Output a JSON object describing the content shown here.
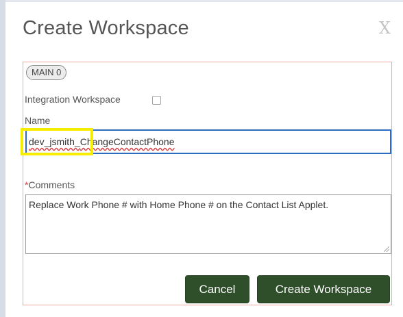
{
  "dialog": {
    "title": "Create Workspace",
    "close_symbol": "X"
  },
  "form": {
    "badge": "MAIN 0",
    "integration_label": "Integration Workspace",
    "integration_checked": false,
    "name_label": "Name",
    "name_value_prefix": "dev_jsmith_",
    "name_value_rest": "ChangeContactPhone",
    "required_marker": "*",
    "comments_label": "Comments",
    "comments_value": "Replace Work Phone # with Home Phone # on the Contact List Applet."
  },
  "buttons": {
    "cancel": "Cancel",
    "create": "Create Workspace"
  },
  "colors": {
    "primary_button": "#2f4f2a",
    "focus_border": "#2d6ac2",
    "panel_border": "#f0a8a6",
    "highlight": "#f6ee00",
    "required": "#d93a3a"
  }
}
